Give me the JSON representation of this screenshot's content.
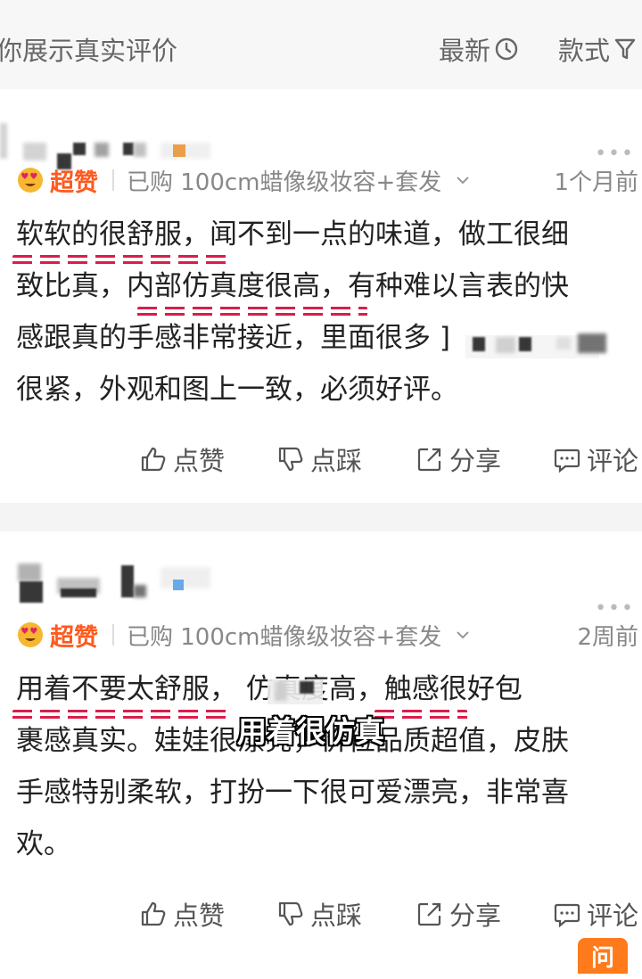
{
  "header": {
    "title": "你展示真实评价",
    "sort_label": "最新",
    "filter_label": "款式"
  },
  "reviews": [
    {
      "badge": "超赞",
      "purchase": "已购 100cm蜡像级妆容+套发",
      "time": "1个月前",
      "lines": [
        "软软的很舒服，闻不到一点的味道，做工很细",
        "致比真，内部仿真度很高，有种难以言表的快",
        "感跟真的手感非常接近，里面很多          ]",
        "很紧，外观和图上一致，必须好评。"
      ],
      "actions": {
        "like": "点赞",
        "dislike": "点踩",
        "share": "分享",
        "comment": "评论"
      }
    },
    {
      "badge": "超赞",
      "purchase": "已购 100cm蜡像级妆容+套发",
      "time": "2周前",
      "lines": [
        "用着不要太舒服，      仿真度高，触感很好包",
        "裹感真实。娃娃很漂亮，价位品质超值，皮肤",
        "手感特别柔软，打扮一下很可爱漂亮，非常喜",
        "欢。"
      ],
      "actions": {
        "like": "点赞",
        "dislike": "点踩",
        "share": "分享",
        "comment": "评论"
      }
    }
  ],
  "overlay_caption": "用着很仿真",
  "ask_button": "问",
  "colors": {
    "badge": "#ff5a1f",
    "underline": "#d81e4a",
    "ask": "#ff7a1a"
  }
}
